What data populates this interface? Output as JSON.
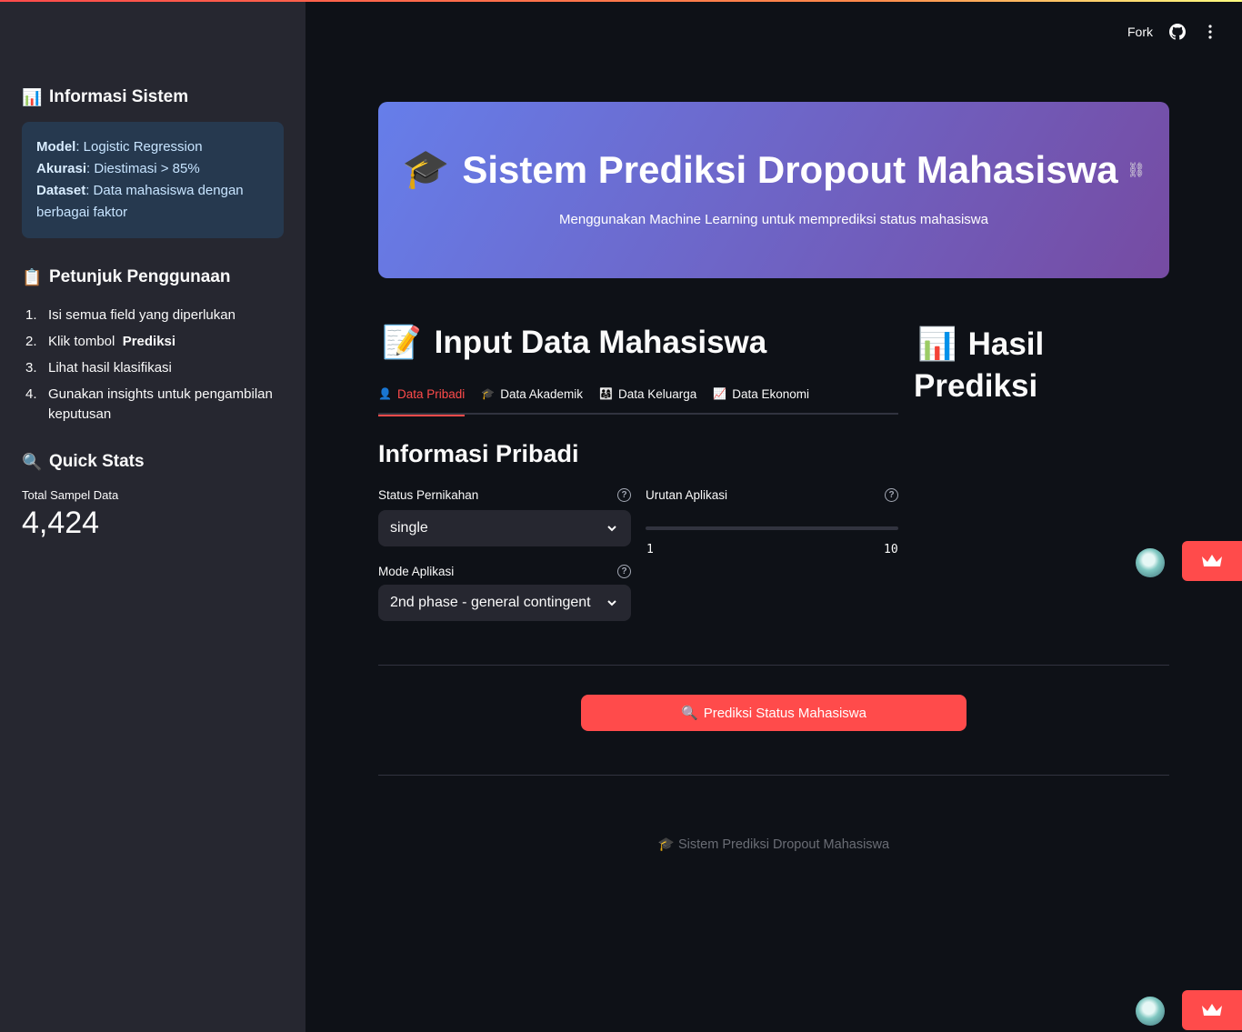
{
  "header": {
    "fork_label": "Fork"
  },
  "sidebar": {
    "info": {
      "title": "Informasi Sistem",
      "title_emoji": "📊",
      "model_key": "Model",
      "model_value": ": Logistic Regression",
      "accuracy_key": "Akurasi",
      "accuracy_value": ": Diestimasi > 85%",
      "dataset_key": "Dataset",
      "dataset_value": ": Data mahasiswa dengan berbagai faktor"
    },
    "guide": {
      "title": "Petunjuk Penggunaan",
      "title_emoji": "📋",
      "steps": [
        {
          "num": "1.",
          "text": "Isi semua field yang diperlukan"
        },
        {
          "num": "2.",
          "text": "Klik tombol ",
          "bold": "Prediksi"
        },
        {
          "num": "3.",
          "text": "Lihat hasil klasifikasi"
        },
        {
          "num": "4.",
          "text": "Gunakan insights untuk pengambilan keputusan"
        }
      ]
    },
    "stats": {
      "title": "Quick Stats",
      "title_emoji": "🔍",
      "metric_label": "Total Sampel Data",
      "metric_value": "4,424"
    }
  },
  "banner": {
    "emoji": "🎓",
    "title": "Sistem Prediksi Dropout Mahasiswa",
    "subtitle": "Menggunakan Machine Learning untuk memprediksi status mahasiswa"
  },
  "input_section": {
    "emoji": "📝",
    "title": "Input Data Mahasiswa"
  },
  "result_section": {
    "emoji": "📊",
    "title_line1": "Hasil",
    "title_line2": "Prediksi"
  },
  "tabs": [
    {
      "emoji": "👤",
      "label": "Data Pribadi",
      "active": true
    },
    {
      "emoji": "🎓",
      "label": "Data Akademik",
      "active": false
    },
    {
      "emoji": "👨‍👩‍👧",
      "label": "Data Keluarga",
      "active": false
    },
    {
      "emoji": "📈",
      "label": "Data Ekonomi",
      "active": false
    }
  ],
  "form": {
    "section_title": "Informasi Pribadi",
    "marital_label": "Status Pernikahan",
    "marital_value": "single",
    "app_mode_label": "Mode Aplikasi",
    "app_mode_value": "2nd phase - general contingent",
    "app_order_label": "Urutan Aplikasi",
    "app_order_min": "1",
    "app_order_max": "10"
  },
  "predict_button": {
    "emoji": "🔍",
    "label": "Prediksi Status Mahasiswa"
  },
  "footer": {
    "emoji": "🎓",
    "text": "Sistem Prediksi Dropout Mahasiswa"
  },
  "colors": {
    "accent": "#ff4b4b",
    "sidebar_bg": "#262730",
    "main_bg": "#0e1117",
    "info_bg": "#26394f"
  }
}
